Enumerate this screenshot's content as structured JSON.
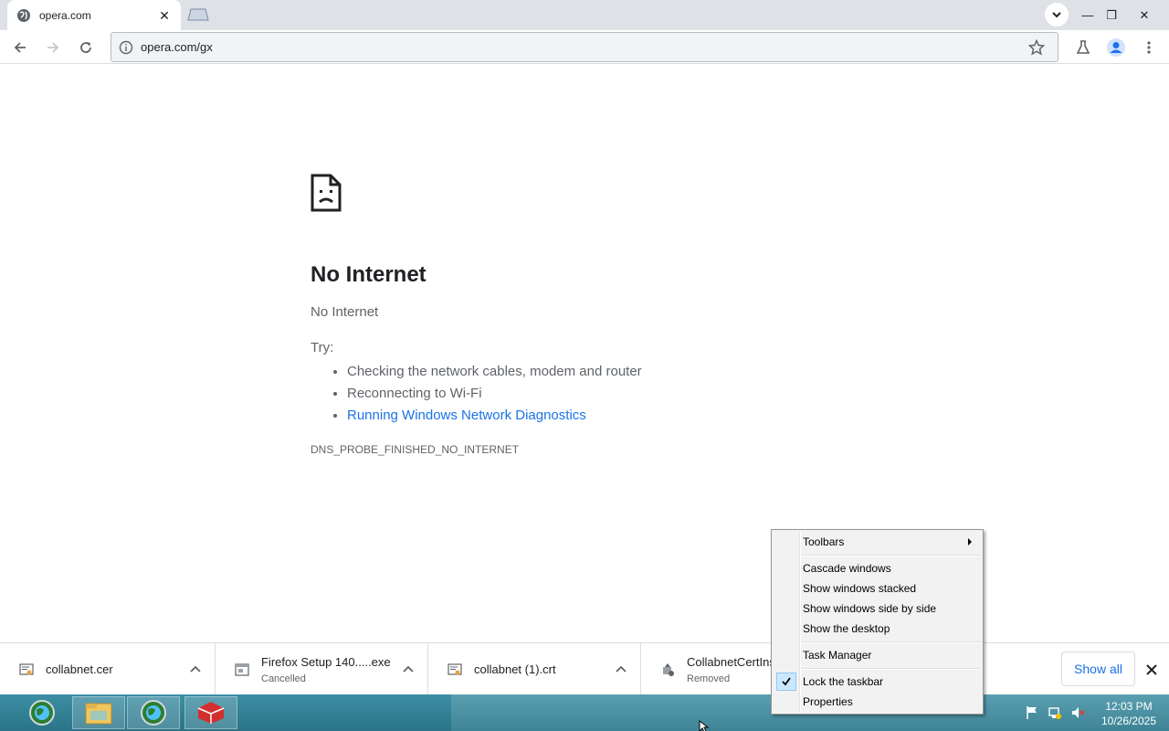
{
  "browser": {
    "tab_title": "opera.com",
    "tab_close": "✕",
    "url": "opera.com/gx",
    "window_minimize": "—",
    "window_restore": "❐",
    "window_close": "✕"
  },
  "error_page": {
    "title": "No Internet",
    "subtitle": "No Internet",
    "try_label": "Try:",
    "suggestions": [
      "Checking the network cables, modem and router",
      "Reconnecting to Wi-Fi",
      "Running Windows Network Diagnostics"
    ],
    "error_code": "DNS_PROBE_FINISHED_NO_INTERNET"
  },
  "downloads": {
    "items": [
      {
        "name": "collabnet.cer",
        "status": ""
      },
      {
        "name": "Firefox Setup 140.....exe",
        "status": "Cancelled"
      },
      {
        "name": "collabnet (1).crt",
        "status": ""
      },
      {
        "name": "CollabnetCertIns",
        "status": "Removed"
      }
    ],
    "show_all": "Show all"
  },
  "context_menu": {
    "items": [
      {
        "label": "Toolbars"
      },
      {
        "label": "Cascade windows"
      },
      {
        "label": "Show windows stacked"
      },
      {
        "label": "Show windows side by side"
      },
      {
        "label": "Show the desktop"
      },
      {
        "label": "Task Manager"
      },
      {
        "label": "Lock the taskbar",
        "checked": true
      },
      {
        "label": "Properties"
      }
    ]
  },
  "taskbar": {
    "time": "12:03 PM",
    "date": "10/26/2025"
  },
  "colors": {
    "link": "#1a73e8",
    "taskbar": "#3e8496",
    "menu_bg": "#f2f2f2"
  }
}
